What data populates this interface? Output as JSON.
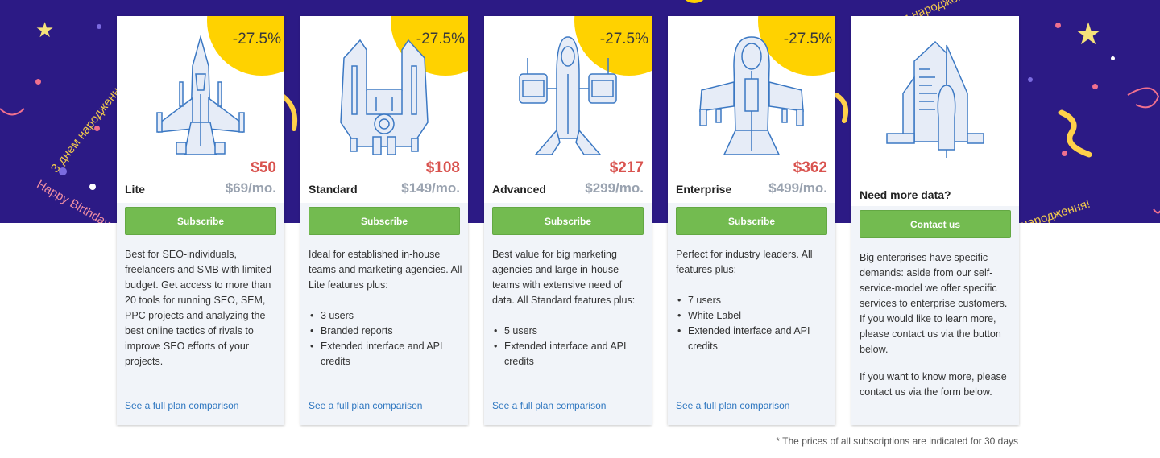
{
  "banner": {
    "greetings": [
      "З днем народження",
      "Happy Birthday",
      "з днем народження!",
      "народження!"
    ]
  },
  "plans": [
    {
      "discount": "-27.5%",
      "price": "$50",
      "name": "Lite",
      "old_price": "$69/mo.",
      "button": "Subscribe",
      "description": "Best for SEO-individuals, freelancers and SMB with limited budget. Get access to more than 20 tools for running SEO, SEM, PPC projects and analyzing the best online tactics of rivals to improve SEO efforts of your projects.",
      "features": [],
      "link": "See a full plan comparison",
      "icon": "spaceship-lite-icon"
    },
    {
      "discount": "-27.5%",
      "price": "$108",
      "name": "Standard",
      "old_price": "$149/mo.",
      "button": "Subscribe",
      "description": "Ideal for established in-house teams and marketing agencies. All Lite features plus:",
      "features": [
        "3 users",
        "Branded reports",
        "Extended interface and API credits"
      ],
      "link": "See a full plan comparison",
      "icon": "spaceship-standard-icon"
    },
    {
      "discount": "-27.5%",
      "price": "$217",
      "name": "Advanced",
      "old_price": "$299/mo.",
      "button": "Subscribe",
      "description": "Best value for big marketing agencies and large in-house teams with extensive need of data. All Standard features plus:",
      "features": [
        "5 users",
        "Extended interface and API credits"
      ],
      "link": "See a full plan comparison",
      "icon": "spaceship-advanced-icon"
    },
    {
      "discount": "-27.5%",
      "price": "$362",
      "name": "Enterprise",
      "old_price": "$499/mo.",
      "button": "Subscribe",
      "description": "Perfect for industry leaders. All features plus:",
      "features": [
        "7 users",
        "White Label",
        "Extended interface and API credits"
      ],
      "link": "See a full plan comparison",
      "icon": "spaceship-enterprise-icon"
    }
  ],
  "contact": {
    "title": "Need more data?",
    "button": "Contact us",
    "paragraph1": "Big enterprises have specific demands: aside from our self-service-model we offer specific services to enterprise customers. If you would like to learn more, please contact us via the button below.",
    "paragraph2": "If you want to know more, please contact us via the form below.",
    "icon": "space-station-icon"
  },
  "footnote": "* The prices of all subscriptions are indicated for 30 days",
  "colors": {
    "banner": "#2c1a85",
    "discount": "#ffd200",
    "price": "#d9534f",
    "button": "#73bb50",
    "link": "#2f77c0"
  }
}
